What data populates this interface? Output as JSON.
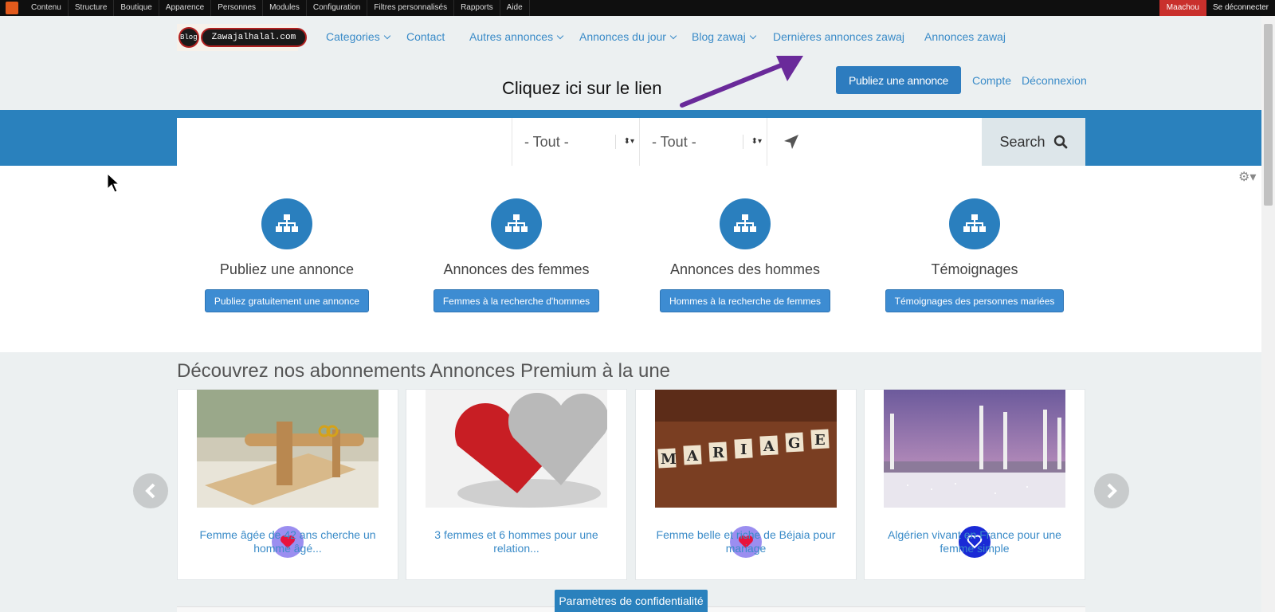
{
  "admin_bar": {
    "items": [
      "Contenu",
      "Structure",
      "Boutique",
      "Apparence",
      "Personnes",
      "Modules",
      "Configuration",
      "Filtres personnalisés",
      "Rapports",
      "Aide"
    ],
    "user": "Maachou",
    "logout": "Se déconnecter"
  },
  "logo": {
    "blog": "Blog",
    "name": "Zawajalhalal.com"
  },
  "nav": {
    "items": [
      "Categories",
      "Contact",
      "Autres annonces",
      "Annonces du jour",
      "Blog zawaj",
      "Dernières annonces zawaj",
      "Annonces zawaj"
    ]
  },
  "header": {
    "publish_button": "Publiez une annonce",
    "account": "Compte",
    "logout": "Déconnexion"
  },
  "annotation": {
    "text": "Cliquez ici sur le lien"
  },
  "search": {
    "keyword_value": "",
    "select1_value": "- Tout -",
    "select2_value": "- Tout -",
    "location_value": "",
    "button": "Search"
  },
  "features": [
    {
      "title": "Publiez une annonce",
      "button": "Publiez gratuitement une annonce"
    },
    {
      "title": "Annonces des femmes",
      "button": "Femmes à la recherche d'hommes"
    },
    {
      "title": "Annonces des hommes",
      "button": "Hommes à la recherche de femmes"
    },
    {
      "title": "Témoignages",
      "button": "Témoignages des personnes mariées"
    }
  ],
  "premium": {
    "title": "Découvrez nos abonnements Annonces Premium à la une",
    "cards": [
      {
        "text": "Femme âgée de 42 ans cherche un homme âgé..."
      },
      {
        "text": "3 femmes et 6 hommes pour une relation..."
      },
      {
        "text": "Femme belle et riche de Béjaia pour mariage"
      },
      {
        "text": "Algérien vivant en France pour une femme simple"
      }
    ]
  },
  "privacy_button": "Paramètres de confidentialité",
  "colors": {
    "primary": "#2a81bd",
    "link": "#3a8bc8",
    "header_bg": "#ecf0f1",
    "admin_user": "#c9302c"
  }
}
